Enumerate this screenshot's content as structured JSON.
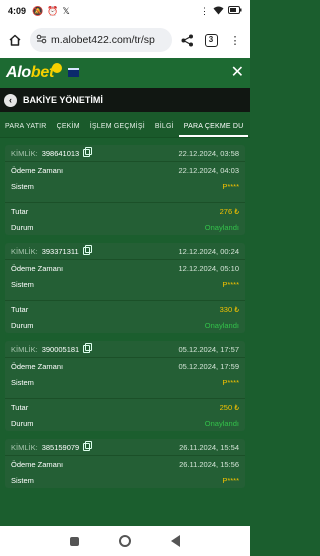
{
  "status_bar": {
    "time": "4:09",
    "left_icons": [
      "mute-icon",
      "alarm-icon",
      "x-icon"
    ],
    "battery_text": "",
    "right_icons": [
      "dots-icon",
      "wifi-icon",
      "battery-icon"
    ]
  },
  "browser": {
    "url": "m.alobet422.com/tr/sp",
    "tab_count": "3"
  },
  "site": {
    "logo_left": "Alo",
    "logo_right": "bet"
  },
  "section": {
    "title": "BAKİYE YÖNETİMİ"
  },
  "tabs": [
    {
      "label": "PARA YATIR"
    },
    {
      "label": "ÇEKİM"
    },
    {
      "label": "İŞLEM GEÇMİŞİ"
    },
    {
      "label": "BİLGİ"
    },
    {
      "label": "PARA ÇEKME DU"
    }
  ],
  "labels": {
    "kimlik": "KİMLİK:",
    "odeme_zamani": "Ödeme Zamanı",
    "sistem": "Sistem",
    "tutar": "Tutar",
    "durum": "Durum"
  },
  "records": [
    {
      "id": "398641013",
      "created": "22.12.2024, 03:58",
      "paid": "22.12.2024, 04:03",
      "system": "P****",
      "amount": "276 ₺",
      "status": "Onaylandı"
    },
    {
      "id": "393371311",
      "created": "12.12.2024, 00:24",
      "paid": "12.12.2024, 05:10",
      "system": "P****",
      "amount": "330 ₺",
      "status": "Onaylandı"
    },
    {
      "id": "390005181",
      "created": "05.12.2024, 17:57",
      "paid": "05.12.2024, 17:59",
      "system": "P****",
      "amount": "250 ₺",
      "status": "Onaylandı"
    },
    {
      "id": "385159079",
      "created": "26.11.2024, 15:54",
      "paid": "26.11.2024, 15:56",
      "system": "P****",
      "amount": "",
      "status": ""
    }
  ],
  "colors": {
    "background": "#1b5e2e",
    "card": "#245f35",
    "amount_yellow": "#f6c200",
    "status_green": "#33c14a"
  }
}
